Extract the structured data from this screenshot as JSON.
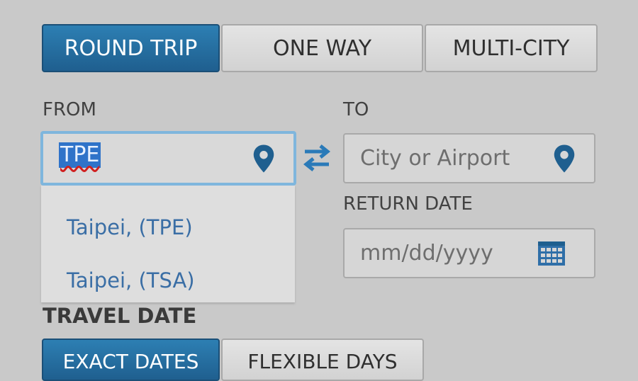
{
  "trip_tabs": [
    {
      "label": "ROUND TRIP",
      "active": true
    },
    {
      "label": "ONE WAY",
      "active": false
    },
    {
      "label": "MULTI-CITY",
      "active": false
    }
  ],
  "from": {
    "label": "FROM",
    "value": "TPE"
  },
  "to": {
    "label": "TO",
    "placeholder": "City or Airport"
  },
  "return_date": {
    "label": "RETURN DATE",
    "placeholder": "mm/dd/yyyy"
  },
  "suggestions": [
    "Taipei, (TPE)",
    "Taipei, (TSA)"
  ],
  "travel_date": {
    "label": "TRAVEL DATE",
    "tabs": [
      {
        "label": "EXACT DATES",
        "active": true
      },
      {
        "label": "FLEXIBLE DAYS",
        "active": false
      }
    ]
  },
  "colors": {
    "accent": "#2669a0",
    "icon": "#1f5f8f",
    "suggestion_text": "#3a6ea5"
  }
}
